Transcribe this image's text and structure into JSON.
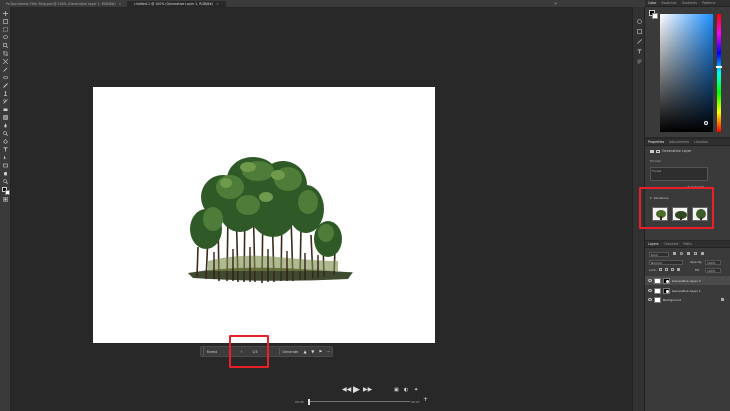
{
  "document_tabs": [
    {
      "label": "Ps Documents Title: Ring.psd @ 100% (Generative Layer 1, RGB/8#)",
      "active": false
    },
    {
      "label": "Untitled-1 @ 100% (Generative Layer 1, RGB/8#)",
      "active": true
    }
  ],
  "tabbar_menu_glyph": "»",
  "color_panel": {
    "tabs": [
      "Color",
      "Swatches",
      "Gradients",
      "Patterns"
    ],
    "foreground": "#000000",
    "background": "#ffffff"
  },
  "properties_panel": {
    "tabs": [
      "Properties",
      "Adjustments",
      "Libraries"
    ],
    "layer_kind": "Generative Layer",
    "prompt_label": "Prompt",
    "prompt_value": "Forest",
    "generate_label": "Generate",
    "variations_label": "Variations",
    "variations": [
      "variation-1",
      "variation-2",
      "variation-3"
    ]
  },
  "layers_panel": {
    "tabs": [
      "Layers",
      "Channels",
      "Paths"
    ],
    "filter_kind": "Kind",
    "blend_mode": "Normal",
    "opacity_label": "Opacity:",
    "opacity_value": "100%",
    "lock_label": "Lock:",
    "fill_label": "Fill:",
    "fill_value": "100%",
    "layers": [
      {
        "name": "Generative Layer 2",
        "selected": true
      },
      {
        "name": "Generative Layer 1",
        "selected": false
      },
      {
        "name": "Background",
        "selected": false
      }
    ]
  },
  "task_bar": {
    "prompt_field": "Forest",
    "prev_glyph": "‹",
    "page_indicator": "1/3",
    "next_glyph": "›",
    "generate_label": "Generate",
    "more_glyph": "···"
  },
  "player": {
    "current_time": "00:03",
    "total_time": "00:27"
  },
  "colors": {
    "highlight": "#e8202a",
    "accent_blue": "#1d8fff"
  }
}
